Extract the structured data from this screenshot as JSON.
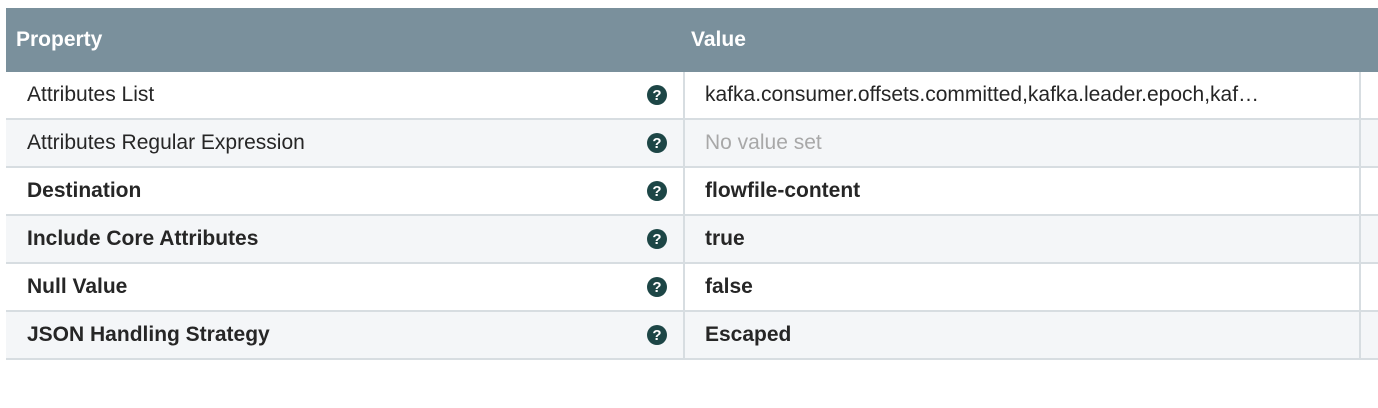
{
  "header": {
    "property": "Property",
    "value": "Value"
  },
  "rows": [
    {
      "name": "Attributes List",
      "value": "kafka.consumer.offsets.committed,kafka.leader.epoch,kaf…",
      "bold": false,
      "empty": false
    },
    {
      "name": "Attributes Regular Expression",
      "value": "No value set",
      "bold": false,
      "empty": true
    },
    {
      "name": "Destination",
      "value": "flowfile-content",
      "bold": true,
      "empty": false
    },
    {
      "name": "Include Core Attributes",
      "value": "true",
      "bold": true,
      "empty": false
    },
    {
      "name": "Null Value",
      "value": "false",
      "bold": true,
      "empty": false
    },
    {
      "name": "JSON Handling Strategy",
      "value": "Escaped",
      "bold": true,
      "empty": false
    }
  ],
  "icons": {
    "help": "question-circle-icon"
  },
  "colors": {
    "header": "#7a909c",
    "help": "#1d4646"
  }
}
